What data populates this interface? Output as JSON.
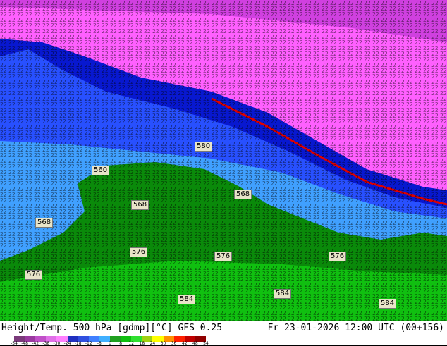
{
  "title": {
    "left": "Height/Temp. 500 hPa [gdmp][°C] GFS 0.25",
    "right": "Fr 23-01-2026 12:00 UTC (00+156)"
  },
  "contour_labels": [
    "580",
    "560",
    "568",
    "568",
    "568",
    "576",
    "576",
    "576",
    "576",
    "584",
    "584",
    "584"
  ],
  "colorbar": {
    "ticks": [
      "-54",
      "-48",
      "-42",
      "-38",
      "-30",
      "-24",
      "-18",
      "-12",
      "-8",
      "0",
      "8",
      "12",
      "18",
      "24",
      "30",
      "36",
      "42",
      "48",
      "54"
    ],
    "colors": [
      "#7a3a7a",
      "#9a3aa0",
      "#c050c8",
      "#e070e8",
      "#ff80ff",
      "#2030c0",
      "#3050e0",
      "#4080ff",
      "#40b0ff",
      "#20a020",
      "#10c010",
      "#30e030",
      "#a0d010",
      "#ffff00",
      "#ff9000",
      "#ff2000",
      "#c00000",
      "#900000"
    ]
  }
}
